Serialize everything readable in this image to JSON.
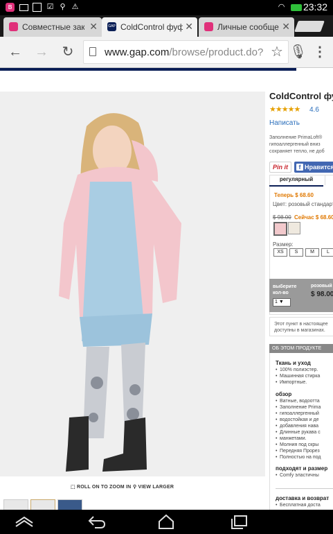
{
  "status_bar": {
    "time": "23:32",
    "left_icons": [
      "app-notification-icon",
      "mail-icon",
      "image-icon",
      "checkbox-icon",
      "usb-icon",
      "warning-icon"
    ],
    "right_icons": [
      "wifi-icon",
      "battery-icon"
    ]
  },
  "tabs": [
    {
      "title": "Совместные зак",
      "favicon_color": "#e0307a",
      "active": false
    },
    {
      "title": "ColdControl фуф",
      "favicon_color": "#0b1f56",
      "active": true,
      "favicon_text": "GAP"
    },
    {
      "title": "Личные сообще",
      "favicon_color": "#e0307a",
      "active": false
    }
  ],
  "address_bar": {
    "url_host": "www.gap.com",
    "url_path": "/browse/product.do?"
  },
  "product": {
    "title": "ColdControl фуф",
    "stars": "★★★★★",
    "rating": "4.6",
    "write_review": "Написать",
    "description": [
      "Заполнение PrimaLoft®",
      "гипоаллергенный вниз",
      "сохраняет тепло, не доб"
    ],
    "pinit": "Pin it",
    "fb_like": "Нравится",
    "tab_regular": "регулярный",
    "now_price": "Теперь $ 68.60",
    "color_label": "Цвет: розовый стандарт",
    "old_price": "$ 98.00",
    "sale_price": "Сейчас $ 68.60",
    "swatch_colors": [
      "#f2c9cc",
      "#efe9df"
    ],
    "size_label": "Размер:",
    "sizes": [
      "XS",
      "S",
      "M",
      "L"
    ],
    "qty_label": [
      "выберите",
      "кол-во"
    ],
    "qty_value": "1 ▼",
    "retail_label": "розовый",
    "total_price": "$ 98.00",
    "instore_note": [
      "Этот пункт в настоящее",
      "доступны в магазинах."
    ],
    "about_header": "ОБ ЭТОМ ПРОДУКТЕ",
    "fabric_title": "Ткань и уход",
    "fabric_items": [
      "100% полиэстер.",
      "Машинная стирка",
      "Импортные."
    ],
    "overview_title": "обзор",
    "overview_items": [
      "Ватные, водоотта",
      "Заполнение Prima",
      "гипоаллергенный",
      "водостойкая и де",
      "добавления нава",
      "Длинные рукава с",
      "манжетами.",
      "Молния под скры",
      "Передняя Прорез",
      "Полностью на под"
    ],
    "fit_title": "подходят и размер",
    "fit_items": [
      "Comfy эластичны"
    ],
    "shipping_title": "доставка и возврат",
    "shipping_items": [
      "Бесплатная доста"
    ]
  },
  "image_controls": {
    "zoom_label": "ROLL ON TO ZOOM IN",
    "view_larger": "VIEW LARGER"
  },
  "nav_bar": [
    "back-icon",
    "home-icon",
    "recent-apps-icon",
    "collapse-icon"
  ]
}
